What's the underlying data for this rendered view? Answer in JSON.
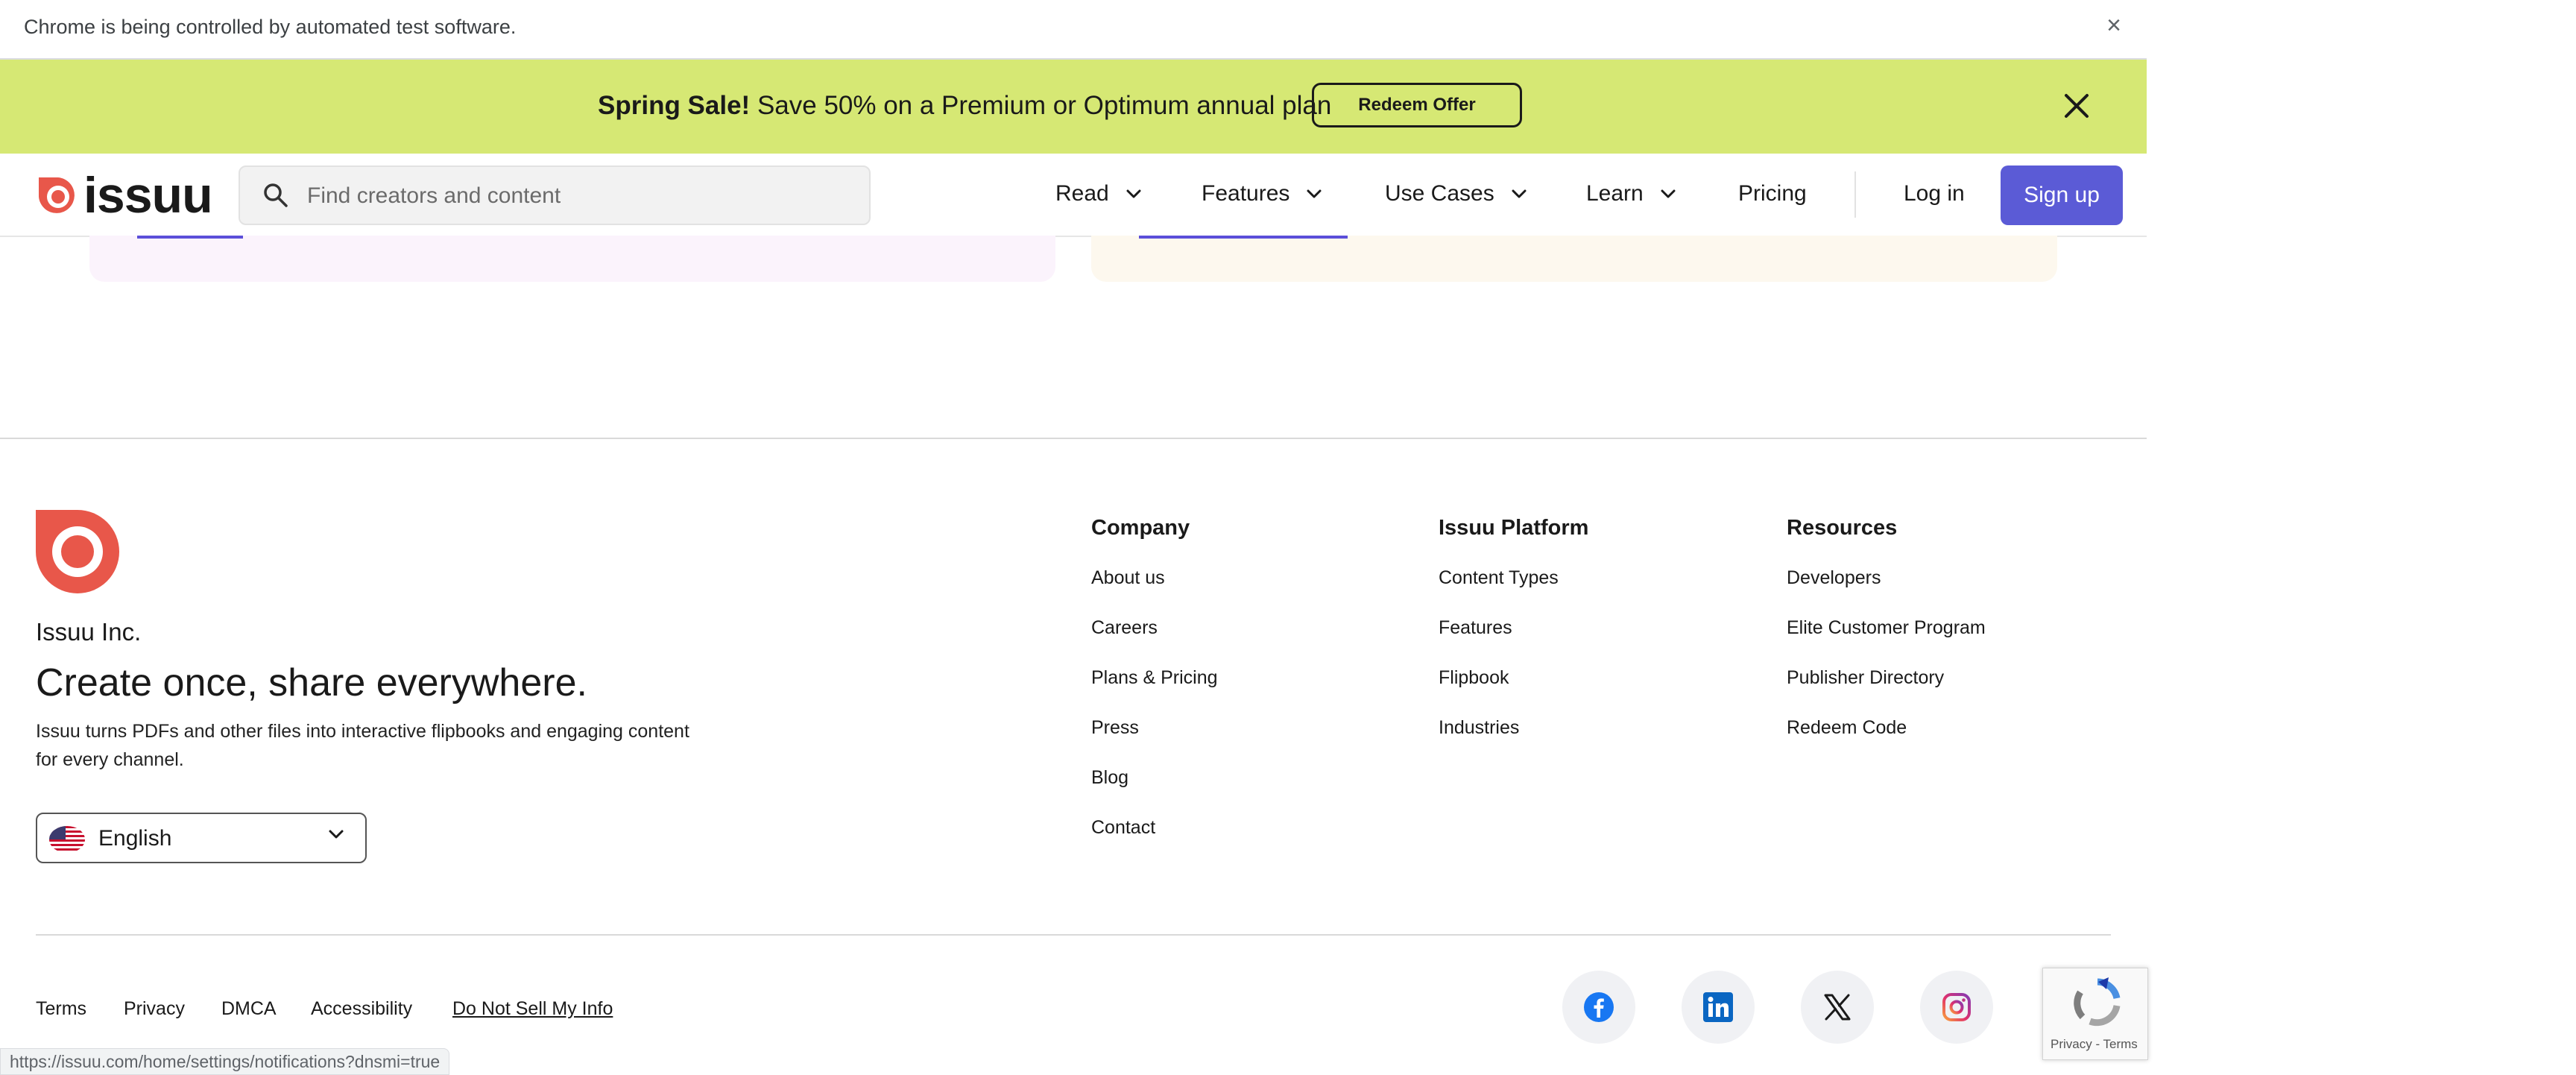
{
  "browser": {
    "automation_message": "Chrome is being controlled by automated test software.",
    "status_url": "https://issuu.com/home/settings/notifications?dnsmi=true"
  },
  "promo": {
    "bold": "Spring Sale!",
    "text": " Save 50% on a Premium or Optimum annual plan",
    "button": "Redeem Offer",
    "background": "#d6e874"
  },
  "nav": {
    "logo_text": "issuu",
    "search_placeholder": "Find creators and content",
    "items": [
      {
        "label": "Read"
      },
      {
        "label": "Features"
      },
      {
        "label": "Use Cases"
      },
      {
        "label": "Learn"
      },
      {
        "label": "Pricing"
      }
    ],
    "login": "Log in",
    "signup": "Sign up",
    "accent": "#5b5bd6"
  },
  "footer": {
    "company": "Issuu Inc.",
    "tagline": "Create once, share everywhere.",
    "description": "Issuu turns PDFs and other files into interactive flipbooks and engaging content for every channel.",
    "language": "English",
    "brand_color": "#e8574a",
    "columns": [
      {
        "title": "Company",
        "links": [
          "About us",
          "Careers",
          "Plans & Pricing",
          "Press",
          "Blog",
          "Contact"
        ]
      },
      {
        "title": "Issuu Platform",
        "links": [
          "Content Types",
          "Features",
          "Flipbook",
          "Industries"
        ]
      },
      {
        "title": "Resources",
        "links": [
          "Developers",
          "Elite Customer Program",
          "Publisher Directory",
          "Redeem Code"
        ]
      }
    ],
    "legal": [
      "Terms",
      "Privacy",
      "DMCA",
      "Accessibility",
      "Do Not Sell My Info"
    ],
    "social": [
      "facebook-icon",
      "linkedin-icon",
      "x-icon",
      "instagram-icon"
    ]
  },
  "recaptcha": {
    "text": "Privacy - Terms"
  }
}
